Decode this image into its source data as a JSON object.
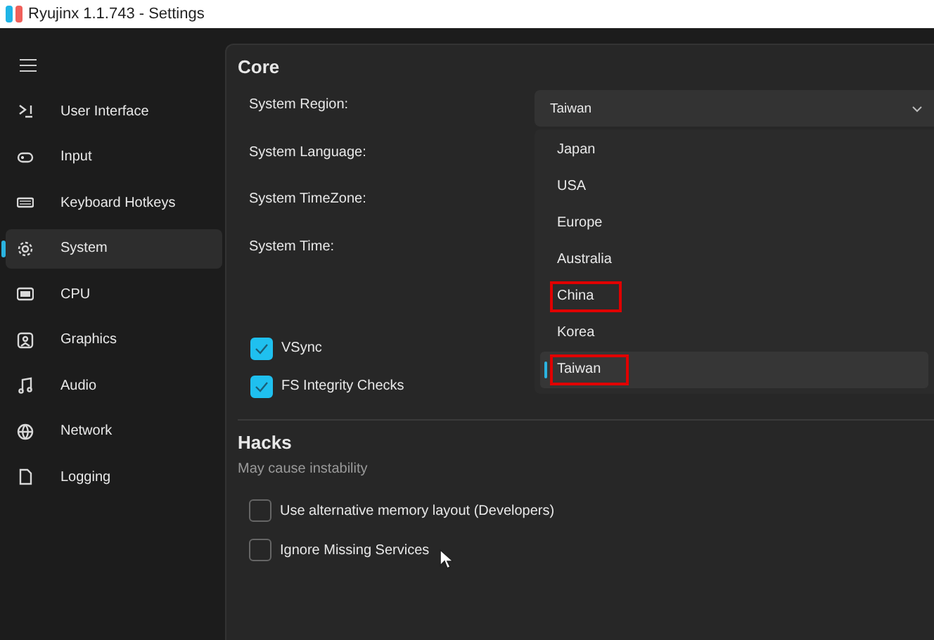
{
  "window": {
    "title": "Ryujinx 1.1.743 - Settings"
  },
  "sidebar": {
    "items": [
      {
        "label": "User Interface",
        "selected": false
      },
      {
        "label": "Input",
        "selected": false
      },
      {
        "label": "Keyboard Hotkeys",
        "selected": false
      },
      {
        "label": "System",
        "selected": true
      },
      {
        "label": "CPU",
        "selected": false
      },
      {
        "label": "Graphics",
        "selected": false
      },
      {
        "label": "Audio",
        "selected": false
      },
      {
        "label": "Network",
        "selected": false
      },
      {
        "label": "Logging",
        "selected": false
      }
    ]
  },
  "core": {
    "title": "Core",
    "rows": [
      {
        "label": "System Region:"
      },
      {
        "label": "System Language:"
      },
      {
        "label": "System TimeZone:"
      },
      {
        "label": "System Time:"
      }
    ],
    "region_dropdown": {
      "value": "Taiwan",
      "expanded": true,
      "options": [
        {
          "label": "Japan",
          "selected": false,
          "annotated": false
        },
        {
          "label": "USA",
          "selected": false,
          "annotated": false
        },
        {
          "label": "Europe",
          "selected": false,
          "annotated": false
        },
        {
          "label": "Australia",
          "selected": false,
          "annotated": false
        },
        {
          "label": "China",
          "selected": false,
          "annotated": true
        },
        {
          "label": "Korea",
          "selected": false,
          "annotated": false
        },
        {
          "label": "Taiwan",
          "selected": true,
          "annotated": true
        }
      ]
    },
    "checkboxes": [
      {
        "label": "VSync",
        "checked": true
      },
      {
        "label": "FS Integrity Checks",
        "checked": true
      }
    ]
  },
  "hacks": {
    "title": "Hacks",
    "subtitle": "May cause instability",
    "checkboxes": [
      {
        "label": "Use alternative memory layout (Developers)",
        "checked": false
      },
      {
        "label": "Ignore Missing Services",
        "checked": false
      }
    ]
  }
}
